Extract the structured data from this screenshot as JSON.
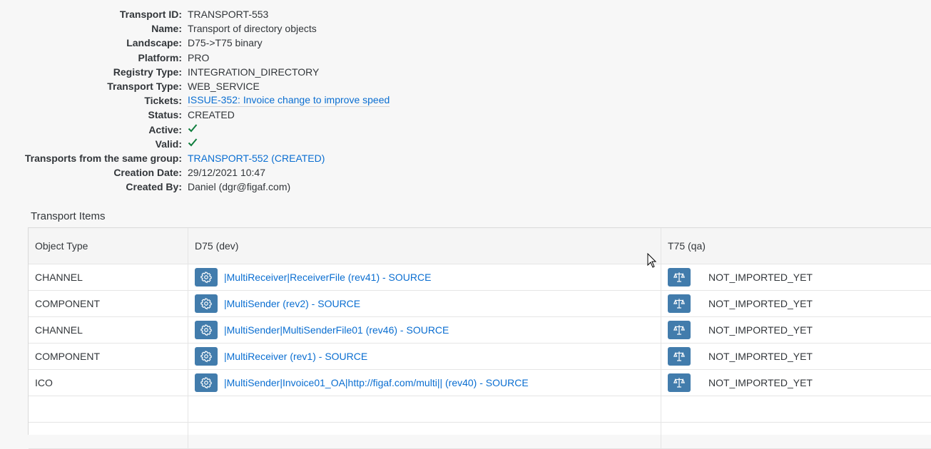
{
  "details": [
    {
      "label": "Transport ID:",
      "value": "TRANSPORT-553",
      "kind": "text"
    },
    {
      "label": "Name:",
      "value": "Transport of directory objects",
      "kind": "text"
    },
    {
      "label": "Landscape:",
      "value": "D75->T75 binary",
      "kind": "text"
    },
    {
      "label": "Platform:",
      "value": "PRO",
      "kind": "text"
    },
    {
      "label": "Registry Type:",
      "value": "INTEGRATION_DIRECTORY",
      "kind": "text"
    },
    {
      "label": "Transport Type:",
      "value": "WEB_SERVICE",
      "kind": "text"
    },
    {
      "label": "Tickets:",
      "value": "ISSUE-352: Invoice change to improve speed",
      "kind": "ticket"
    },
    {
      "label": "Status:",
      "value": "CREATED",
      "kind": "text"
    },
    {
      "label": "Active:",
      "value": null,
      "kind": "check"
    },
    {
      "label": "Valid:",
      "value": null,
      "kind": "check"
    },
    {
      "label": "Transports from the same group:",
      "value": "TRANSPORT-552 (CREATED)",
      "kind": "link"
    },
    {
      "label": "Creation Date:",
      "value": "29/12/2021 10:47",
      "kind": "text"
    },
    {
      "label": "Created By:",
      "value": "Daniel (dgr@figaf.com)",
      "kind": "text"
    }
  ],
  "transport_items": {
    "title": "Transport Items",
    "columns": [
      "Object Type",
      "D75 (dev)",
      "T75 (qa)"
    ],
    "rows": [
      {
        "type": "CHANNEL",
        "source": "|MultiReceiver|ReceiverFile (rev41) - SOURCE",
        "target": "NOT_IMPORTED_YET"
      },
      {
        "type": "COMPONENT",
        "source": "|MultiSender (rev2) - SOURCE",
        "target": "NOT_IMPORTED_YET"
      },
      {
        "type": "CHANNEL",
        "source": "|MultiSender|MultiSenderFile01 (rev46) - SOURCE",
        "target": "NOT_IMPORTED_YET"
      },
      {
        "type": "COMPONENT",
        "source": "|MultiReceiver (rev1) - SOURCE",
        "target": "NOT_IMPORTED_YET"
      },
      {
        "type": "ICO",
        "source": "|MultiSender|Invoice01_OA|http://figaf.com/multi|| (rev40) - SOURCE",
        "target": "NOT_IMPORTED_YET"
      }
    ],
    "empty_rows": 2
  },
  "icons": {
    "source_button": "gear-icon",
    "target_button": "balance-scale-icon",
    "status_check": "checkmark-icon"
  },
  "colors": {
    "link": "#0a6ed1",
    "button": "#427cac",
    "check": "#107e3e"
  }
}
